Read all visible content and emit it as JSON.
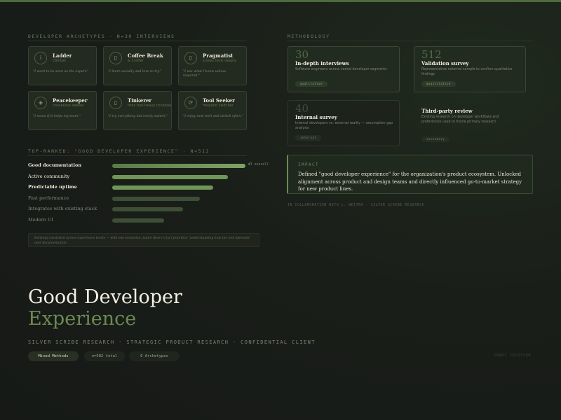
{
  "archetypes": {
    "heading": "DEVELOPER ARCHETYPES · N=30 INTERVIEWS",
    "items": [
      {
        "icon": "ⅰ",
        "name": "Ladder",
        "subtitle": "Climber",
        "quote": "\"I want to be seen as the expert.\""
      },
      {
        "icon": "▯",
        "name": "Coffee Break",
        "subtitle": "& Crafter",
        "quote": "\"I learn socially and love to try.\""
      },
      {
        "icon": "▯",
        "name": "Pragmatist",
        "subtitle": "knows tools deeply",
        "quote": "\"I use what I know unless required.\""
      },
      {
        "icon": "◈",
        "name": "Peacekeeper",
        "subtitle": "consensus seeker",
        "quote": "\"I mean if it helps my team.\""
      },
      {
        "icon": "▯",
        "name": "Tinkerer",
        "subtitle": "tries tool-heavy consoles",
        "quote": "\"I try everything but rarely switch.\""
      },
      {
        "icon": "⟳",
        "name": "Tool Seeker",
        "subtitle": "frequent switcher",
        "quote": "\"I enjoy new tech and switch often.\""
      }
    ]
  },
  "methodology": {
    "heading": "METHODOLOGY",
    "cards": [
      {
        "number": "30",
        "title": "In-depth interviews",
        "desc": "Software engineers across varied developer segments",
        "tag": "qualitative"
      },
      {
        "number": "512",
        "title": "Validation survey",
        "desc": "Representative external sample to confirm qualitative findings",
        "tag": "quantitative"
      },
      {
        "number": "40",
        "title": "Internal survey",
        "desc": "Internal developers vs. external reality — assumption gap analysis",
        "tag": "internal"
      },
      {
        "number": "",
        "title": "Third-party review",
        "desc": "Existing research on developer workflows and preferences used to frame primary research",
        "tag": "secondary"
      }
    ]
  },
  "impact": {
    "label": "IMPACT",
    "text": "Defined \"good developer experience\" for the organization's product ecosystem. Unlocked alignment across product and design teams and directly influenced go-to-market strategy for new product lines."
  },
  "collaboration": "IN COLLABORATION WITH L. WEITRA · SILVER SCRIBE RESEARCH",
  "ranked": {
    "heading": "TOP-RANKED: \"GOOD DEVELOPER EXPERIENCE\" · N=512",
    "top_note": "#1 overall",
    "items": [
      {
        "label": "Good documentation",
        "value": 1.0,
        "highlight": true
      },
      {
        "label": "Active community",
        "value": 0.87,
        "highlight": true
      },
      {
        "label": "Predictable uptime",
        "value": 0.76,
        "highlight": true
      },
      {
        "label": "Fast performance",
        "value": 0.66,
        "highlight": false
      },
      {
        "label": "Integrates with existing stack",
        "value": 0.53,
        "highlight": false
      },
      {
        "label": "Modern UI",
        "value": 0.39,
        "highlight": false
      }
    ],
    "footnote": "Ranking consistent across experience levels — with one exception: junior devs (<1yr) prioritize \"understanding how the tool operates\" over documentation."
  },
  "hero": {
    "title_line1": "Good Developer",
    "title_line2": "Experience",
    "byline": "SILVER SCRIBE RESEARCH · STRATEGIC PRODUCT RESEARCH · CONFIDENTIAL CLIENT",
    "pills": [
      "Mixed Methods",
      "n=582 total",
      "6 Archetypes"
    ],
    "brand": "SMART JULESSUN"
  },
  "colors": {
    "accent": "#6b8a53",
    "bar_strong": "#6f9558",
    "bar_muted": "#3e4e37"
  }
}
